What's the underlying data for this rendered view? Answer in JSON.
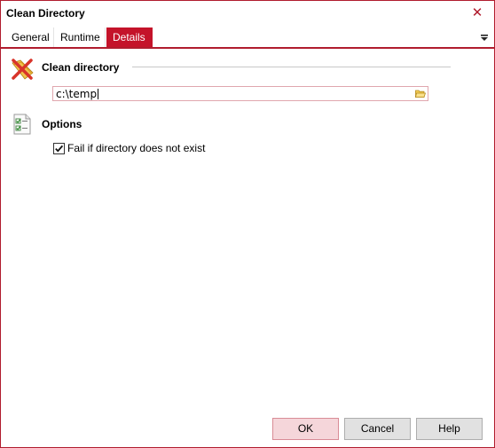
{
  "window": {
    "title": "Clean Directory"
  },
  "tabs": [
    {
      "label": "General"
    },
    {
      "label": "Runtime"
    },
    {
      "label": "Details",
      "selected": true
    }
  ],
  "clean_section": {
    "title": "Clean directory",
    "icon": "clean-directory-icon",
    "path_value": "c:\\temp",
    "browse_icon": "folder-icon"
  },
  "options_section": {
    "title": "Options",
    "icon": "options-checklist-icon",
    "fail_checkbox": {
      "label": "Fail if directory does not exist",
      "checked": true
    }
  },
  "buttons": {
    "ok": "OK",
    "cancel": "Cancel",
    "help": "Help"
  },
  "colors": {
    "accent": "#c4132a",
    "ok_background": "#f5d6da"
  }
}
